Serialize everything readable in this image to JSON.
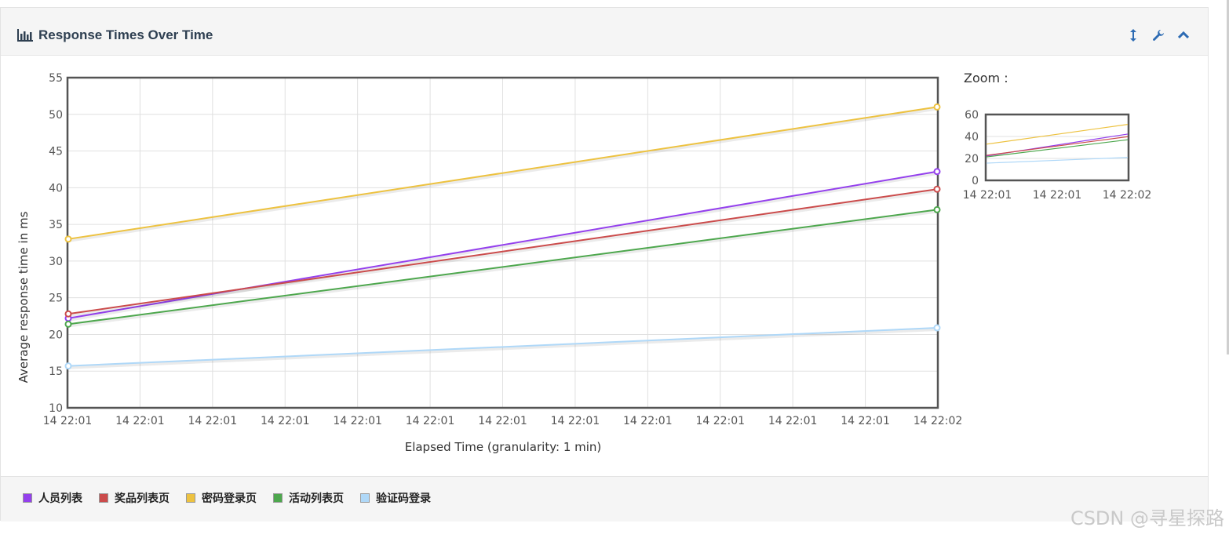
{
  "panel": {
    "title": "Response Times Over Time",
    "title_icon": "bar-chart-icon",
    "tools": [
      "resize-vertical-icon",
      "wrench-icon",
      "chevron-up-icon"
    ]
  },
  "zoom": {
    "label": "Zoom :"
  },
  "chart_data": {
    "type": "line",
    "xlabel": "Elapsed Time (granularity: 1 min)",
    "ylabel": "Average response time in ms",
    "ylim": [
      10,
      55
    ],
    "yticks": [
      10,
      15,
      20,
      25,
      30,
      35,
      40,
      45,
      50,
      55
    ],
    "x": [
      "14 22:01",
      "14 22:02"
    ],
    "xtick_labels": [
      "14 22:01",
      "14 22:01",
      "14 22:01",
      "14 22:01",
      "14 22:01",
      "14 22:01",
      "14 22:01",
      "14 22:01",
      "14 22:01",
      "14 22:01",
      "14 22:01",
      "14 22:01",
      "14 22:02"
    ],
    "grid": true,
    "legend_position": "bottom",
    "series": [
      {
        "name": "人员列表",
        "color": "#9440ed",
        "values": [
          22.2,
          42.2
        ]
      },
      {
        "name": "奖品列表页",
        "color": "#cb4b4b",
        "values": [
          22.8,
          39.8
        ]
      },
      {
        "name": "密码登录页",
        "color": "#edc240",
        "values": [
          33.0,
          51.0
        ]
      },
      {
        "name": "活动列表页",
        "color": "#4da74d",
        "values": [
          21.4,
          37.0
        ]
      },
      {
        "name": "验证码登录",
        "color": "#afd8f8",
        "values": [
          15.7,
          20.9
        ]
      }
    ],
    "overview": {
      "ylim": [
        0,
        60
      ],
      "yticks": [
        0,
        20,
        40,
        60
      ],
      "xtick_labels": [
        "14 22:01",
        "14 22:01",
        "14 22:02"
      ]
    }
  },
  "watermark": "CSDN @寻星探路"
}
